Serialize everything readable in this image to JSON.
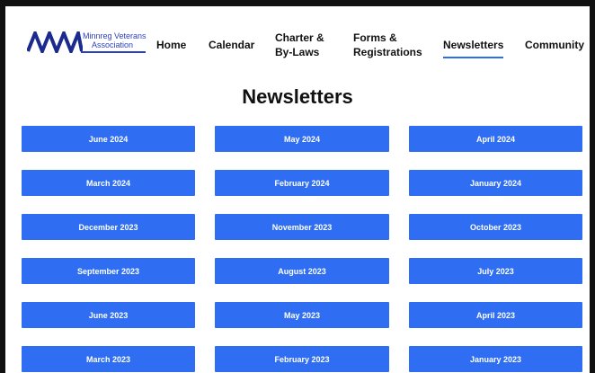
{
  "logo": {
    "line1": "Minnreg Veterans",
    "line2": "Association"
  },
  "nav": {
    "home": "Home",
    "calendar": "Calendar",
    "charter_line1": "Charter &",
    "charter_line2": "By-Laws",
    "forms_line1": "Forms &",
    "forms_line2": "Registrations",
    "newsletters": "Newsletters",
    "community": "Community",
    "active": "Newsletters"
  },
  "page_title": "Newsletters",
  "newsletters": [
    "June 2024",
    "May 2024",
    "April 2024",
    "March 2024",
    "February 2024",
    "January 2024",
    "December 2023",
    "November 2023",
    "October 2023",
    "September 2023",
    "August 2023",
    "July 2023",
    "June 2023",
    "May 2023",
    "April 2023",
    "March 2023",
    "February 2023",
    "January 2023"
  ],
  "colors": {
    "button": "#2f6df2",
    "logo": "#2a3fbf",
    "active_underline": "#2d6cf0"
  }
}
